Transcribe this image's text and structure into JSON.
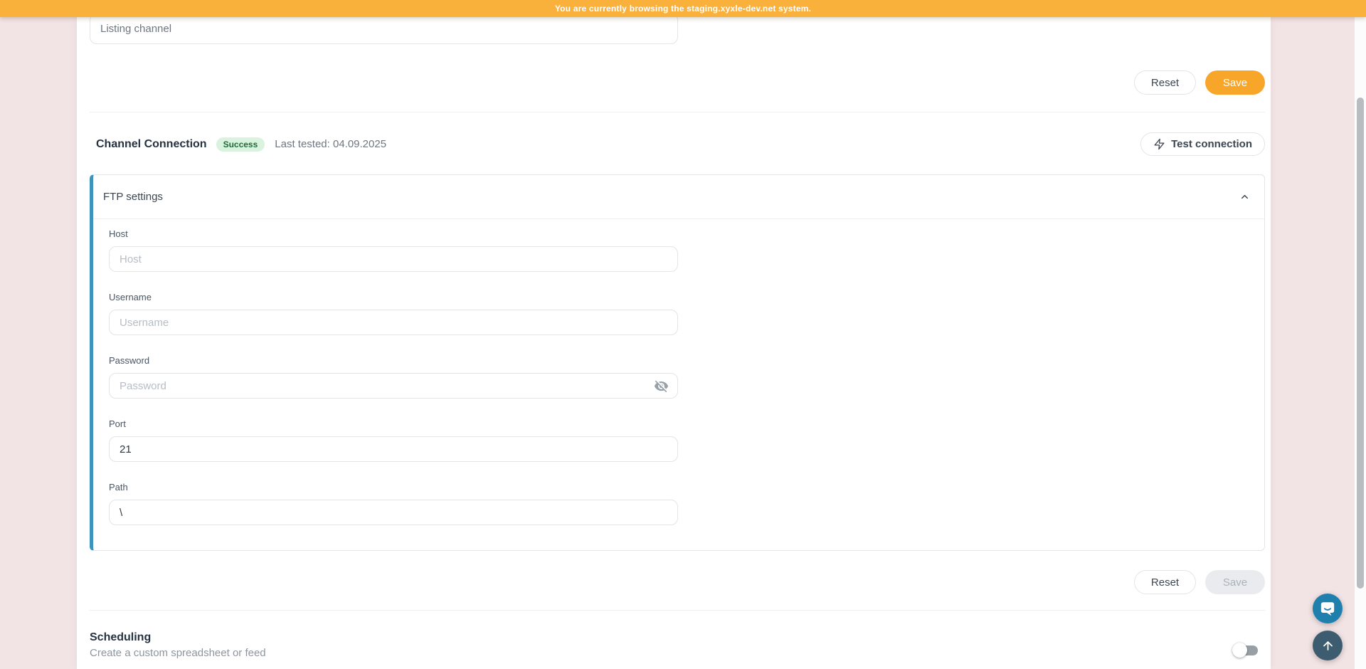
{
  "banner": {
    "text": "You are currently browsing the staging.xyxle-dev.net system."
  },
  "listing": {
    "channel_value": "Listing channel",
    "reset_label": "Reset",
    "save_label": "Save"
  },
  "connection": {
    "title": "Channel Connection",
    "status": "Success",
    "last_tested": "Last tested: 04.09.2025",
    "test_button_label": "Test connection",
    "reset_label": "Reset",
    "save_label": "Save",
    "ftp": {
      "title": "FTP settings",
      "fields": [
        {
          "label": "Host",
          "placeholder": "Host",
          "value": ""
        },
        {
          "label": "Username",
          "placeholder": "Username",
          "value": ""
        },
        {
          "label": "Password",
          "placeholder": "Password",
          "value": ""
        },
        {
          "label": "Port",
          "placeholder": "",
          "value": "21"
        },
        {
          "label": "Path",
          "placeholder": "",
          "value": "\\"
        }
      ]
    }
  },
  "scheduling": {
    "title": "Scheduling",
    "subtitle": "Create a custom spreadsheet or feed",
    "toggle_state": "off"
  },
  "colors": {
    "banner_bg": "#f9b13c",
    "save_bg": "#f8a62a",
    "accent_blue": "#3d93ba",
    "success_bg": "#d9f3de",
    "success_text": "#1e6b3a",
    "chat_bg": "#1f7fad",
    "scrolltop_bg": "#3e5c6f",
    "page_bg": "#f2e3e4"
  }
}
